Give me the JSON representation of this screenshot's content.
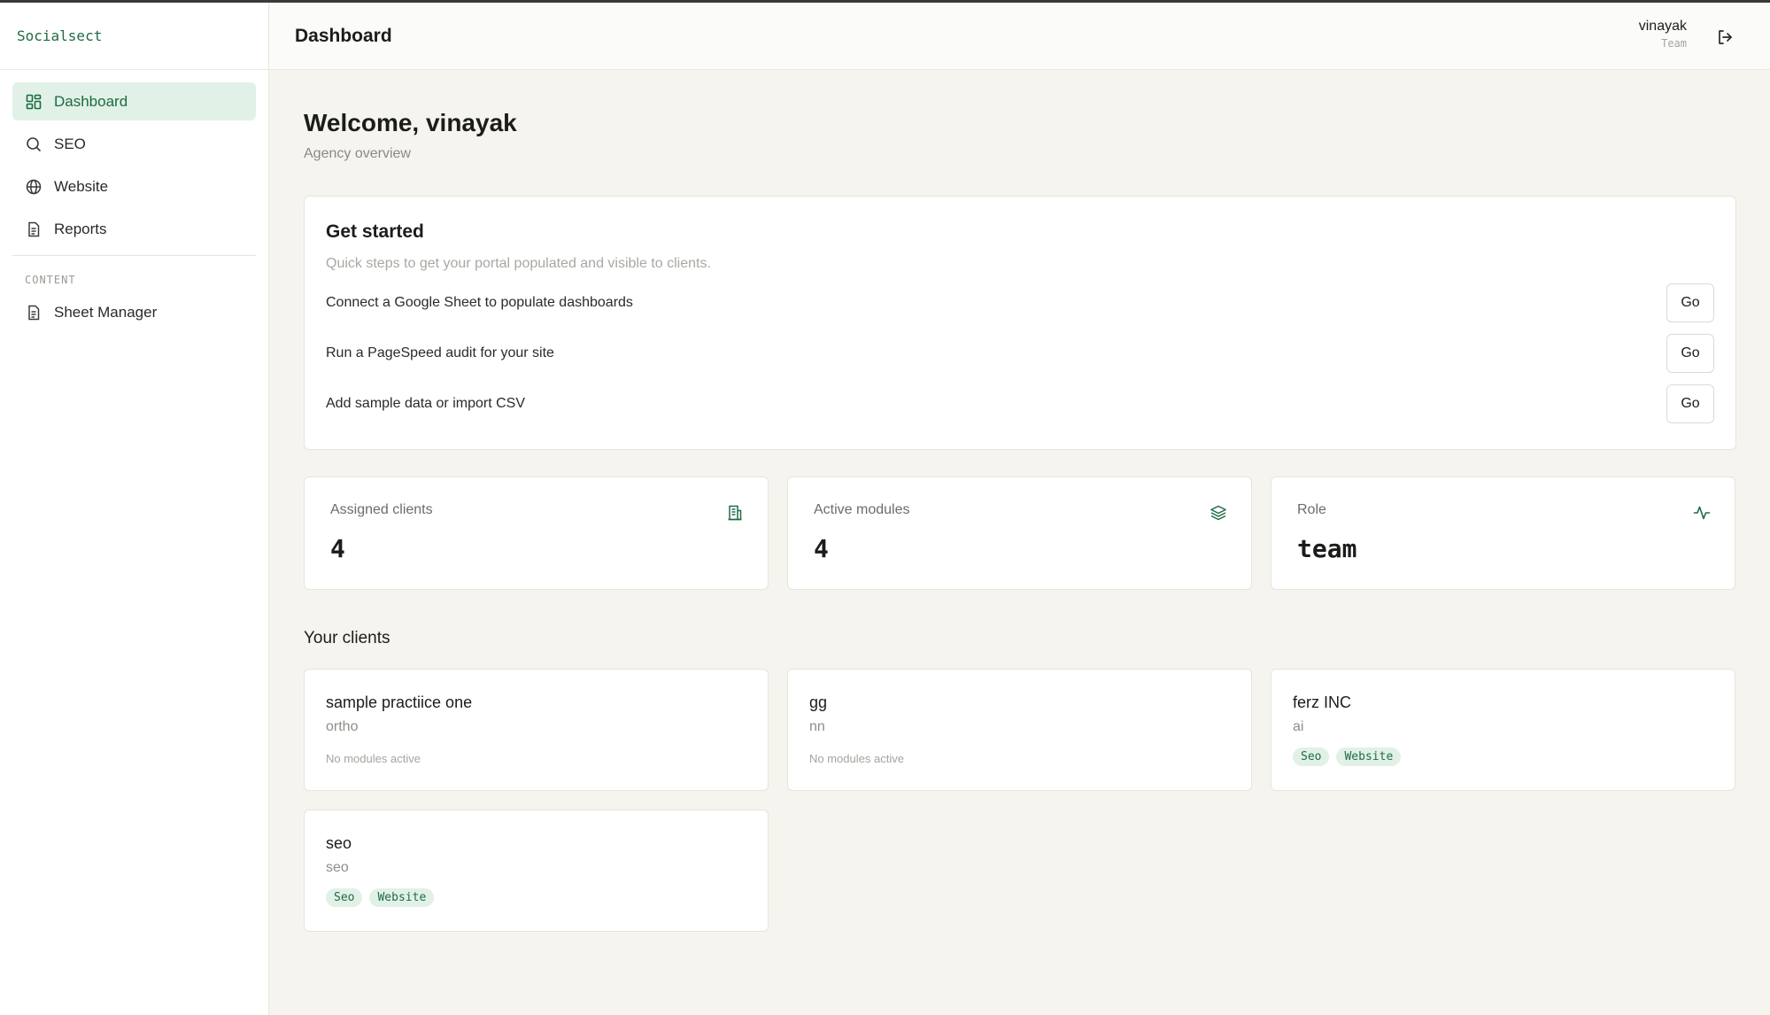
{
  "brand": "Socialsect",
  "sidebar": {
    "items": [
      {
        "label": "Dashboard",
        "icon": "dashboard-grid-icon",
        "active": true
      },
      {
        "label": "SEO",
        "icon": "search-icon"
      },
      {
        "label": "Website",
        "icon": "globe-icon"
      },
      {
        "label": "Reports",
        "icon": "document-icon"
      }
    ],
    "section_label": "CONTENT",
    "section_items": [
      {
        "label": "Sheet Manager",
        "icon": "document-icon"
      }
    ]
  },
  "header": {
    "title": "Dashboard",
    "user_name": "vinayak",
    "user_role": "Team",
    "logout_icon": "logout-icon"
  },
  "main": {
    "welcome": "Welcome, vinayak",
    "subtitle": "Agency overview",
    "get_started": {
      "title": "Get started",
      "subtitle": "Quick steps to get your portal populated and visible to clients.",
      "steps": [
        {
          "label": "Connect a Google Sheet to populate dashboards",
          "button": "Go"
        },
        {
          "label": "Run a PageSpeed audit for your site",
          "button": "Go"
        },
        {
          "label": "Add sample data or import CSV",
          "button": "Go"
        }
      ]
    },
    "stats": [
      {
        "label": "Assigned clients",
        "value": "4",
        "icon": "building-icon"
      },
      {
        "label": "Active modules",
        "value": "4",
        "icon": "layers-icon"
      },
      {
        "label": "Role",
        "value": "team",
        "icon": "activity-icon"
      }
    ],
    "clients_heading": "Your clients",
    "clients": [
      {
        "name": "sample practiice one",
        "sub": "ortho",
        "note": "No modules active",
        "tags": []
      },
      {
        "name": "gg",
        "sub": "nn",
        "note": "No modules active",
        "tags": []
      },
      {
        "name": "ferz INC",
        "sub": "ai",
        "note": "",
        "tags": [
          "Seo",
          "Website"
        ]
      },
      {
        "name": "seo",
        "sub": "seo",
        "note": "",
        "tags": [
          "Seo",
          "Website"
        ]
      }
    ]
  },
  "colors": {
    "accent": "#1f6b45",
    "accent_bg": "#e1f1e7",
    "page_bg": "#f5f4ef"
  }
}
